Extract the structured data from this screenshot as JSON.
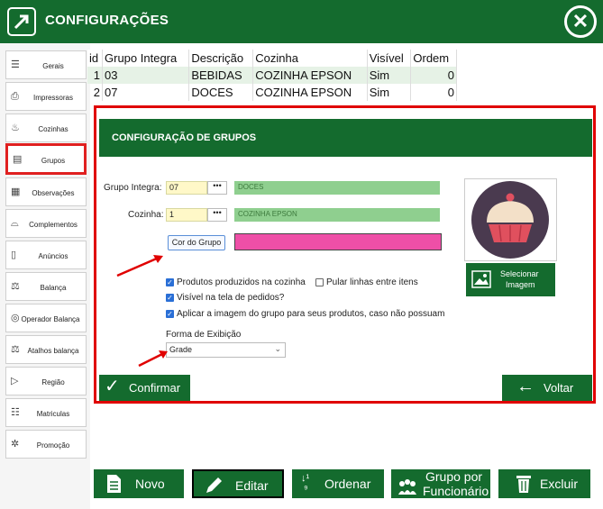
{
  "header": {
    "title": "CONFIGURAÇÕES",
    "close": "✕"
  },
  "sidebar": {
    "items": [
      {
        "label": "Gerais"
      },
      {
        "label": "Impressoras"
      },
      {
        "label": "Cozinhas"
      },
      {
        "label": "Grupos"
      },
      {
        "label": "Observações"
      },
      {
        "label": "Complementos"
      },
      {
        "label": "Anúncios"
      },
      {
        "label": "Balança"
      },
      {
        "label": "Operador  Balança"
      },
      {
        "label": "Atalhos balança"
      },
      {
        "label": "Região"
      },
      {
        "label": "Matriculas"
      },
      {
        "label": "Promoção"
      }
    ]
  },
  "table": {
    "columns": [
      "id",
      "Grupo Integra",
      "Descrição",
      "Cozinha",
      "Visível",
      "Ordem"
    ],
    "rows": [
      [
        "1",
        "03",
        "BEBIDAS",
        "COZINHA EPSON",
        "Sim",
        "0"
      ],
      [
        "2",
        "07",
        "DOCES",
        "COZINHA EPSON",
        "Sim",
        "0"
      ]
    ]
  },
  "dialog": {
    "title": "CONFIGURAÇÃO DE GRUPOS",
    "grupo_integra_label": "Grupo Integra:",
    "grupo_integra_value": "07",
    "grupo_integra_desc": "DOCES",
    "cozinha_label": "Cozinha:",
    "cozinha_value": "1",
    "cozinha_desc": "COZINHA EPSON",
    "dots": "•••",
    "cor_button": "Cor do Grupo",
    "cor_value": "#ee4fa7",
    "checkboxes": [
      {
        "label": "Produtos produzidos na cozinha",
        "checked": true
      },
      {
        "label": "Pular linhas entre itens",
        "checked": false
      },
      {
        "label": "Visível na tela de pedidos?",
        "checked": true
      },
      {
        "label": "Aplicar a imagem do grupo para seus produtos, caso não possuam",
        "checked": true
      }
    ],
    "forma_label": "Forma de Exibição",
    "forma_value": "Grade",
    "selecionar_line1": "Selecionar",
    "selecionar_line2": "Imagem",
    "confirmar": "Confirmar",
    "voltar": "Voltar"
  },
  "toolbar": {
    "novo": "Novo",
    "editar": "Editar",
    "ordenar": "Ordenar",
    "grupo_line1": "Grupo por",
    "grupo_line2": "Funcionário",
    "excluir": "Excluir"
  },
  "colors": {
    "accent": "#146b2e",
    "highlight": "#e00000"
  }
}
